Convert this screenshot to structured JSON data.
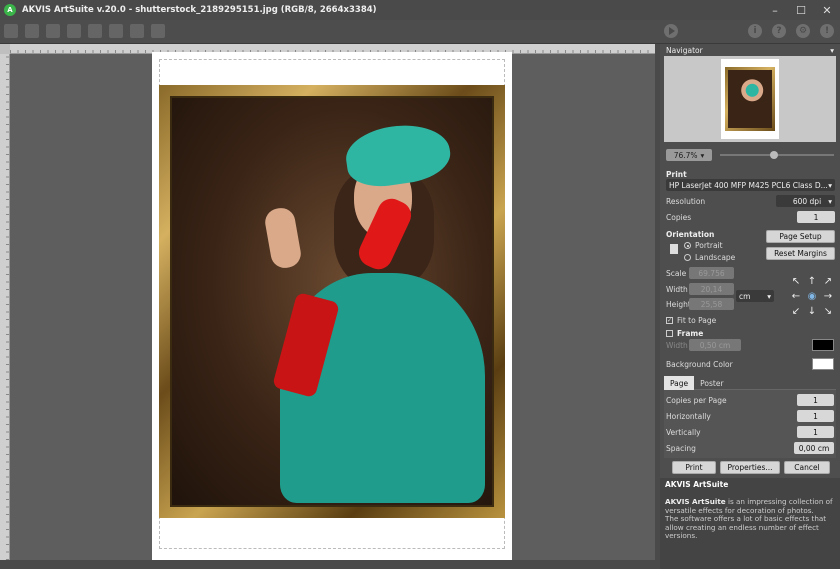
{
  "window": {
    "title": "AKVIS ArtSuite v.20.0 - shutterstock_2189295151.jpg (RGB/8, 2664x3384)",
    "controls": [
      "–",
      "☐",
      "✕"
    ]
  },
  "toolbar": {
    "right_icons": [
      "play-icon",
      "info-icon",
      "help-icon",
      "settings-icon",
      "notification-icon"
    ]
  },
  "navigator": {
    "title": "Navigator",
    "zoom": "76.7%",
    "zoom_slider_fraction": 0.47
  },
  "print": {
    "section_label": "Print",
    "printer": "HP LaserJet 400 MFP M425 PCL6 Class D...",
    "resolution_label": "Resolution",
    "resolution": "600 dpi",
    "copies_label": "Copies",
    "copies": "1",
    "orientation_label": "Orientation",
    "portrait_label": "Portrait",
    "landscape_label": "Landscape",
    "page_setup_label": "Page Setup",
    "reset_margins_label": "Reset Margins",
    "scale_label": "Scale",
    "scale": "69.756",
    "width_label": "Width",
    "width": "20,14",
    "height_label": "Height",
    "height": "25,58",
    "unit": "cm",
    "fit_to_page_label": "Fit to Page",
    "frame_label": "Frame",
    "frame_width_label": "Width",
    "frame_width": "0,50 cm",
    "frame_color": "#000000",
    "background_color_label": "Background Color",
    "background_color": "#ffffff"
  },
  "tabs": {
    "page": "Page",
    "poster": "Poster"
  },
  "page_tab": {
    "copies_per_page_label": "Copies per Page",
    "copies_per_page": "1",
    "horizontally_label": "Horizontally",
    "horizontally": "1",
    "vertically_label": "Vertically",
    "vertically": "1",
    "spacing_label": "Spacing",
    "spacing": "0,00 cm"
  },
  "actions": {
    "print": "Print",
    "properties": "Properties...",
    "cancel": "Cancel"
  },
  "info": {
    "title": "AKVIS ArtSuite",
    "brand": "AKVIS ArtSuite",
    "text1": " is an impressing collection of versatile effects for decoration of photos.",
    "text2": "The software offers a lot of basic effects that allow creating an endless number of effect versions."
  }
}
